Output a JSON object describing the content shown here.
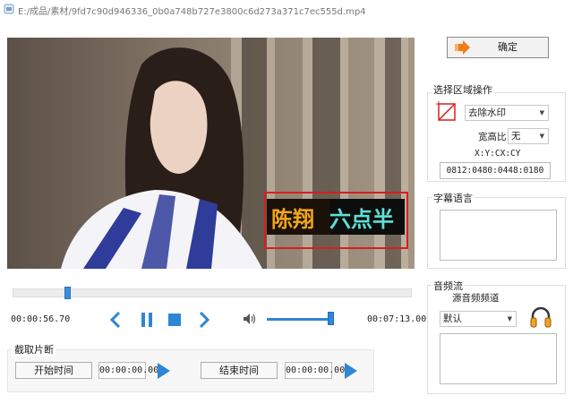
{
  "window": {
    "title": "E:/成品/素材/9fd7c90d946336_0b0a748b727e3800c6d273a371c7ec555d.mp4"
  },
  "video": {
    "overlay_text_left": "陈翔",
    "overlay_text_right": "六点半"
  },
  "playback": {
    "current_time": "00:00:56.70",
    "total_time": "00:07:13.00",
    "progress": 0.13,
    "volume": 0.95
  },
  "clip": {
    "title": "截取片断",
    "start_button": "开始时间",
    "start_value": "00:00:00.00",
    "end_button": "结束时间",
    "end_value": "00:00:00.00"
  },
  "confirm": {
    "label": "确定"
  },
  "region": {
    "title": "选择区域操作",
    "operation": "去除水印",
    "aspect_label": "宽高比",
    "aspect_value": "无",
    "coord_format": "X:Y:CX:CY",
    "coord_value": "0812:0480:0448:0180"
  },
  "subtitle": {
    "title": "字幕语言"
  },
  "audio": {
    "title": "音频流",
    "source_label": "源音频频道",
    "source_value": "默认"
  },
  "colors": {
    "accent": "#2e86d6",
    "selection": "#d81e1e",
    "confirm_icon": "#f07c1a",
    "headphone": "#f2a51c"
  },
  "icons": {
    "app": "app-icon",
    "prev": "chevron-left-icon",
    "pause": "pause-icon",
    "stop": "stop-icon",
    "next": "chevron-right-icon",
    "volume": "speaker-icon",
    "play": "play-icon",
    "confirm": "arrow-right-icon",
    "region": "crop-icon",
    "headphones": "headphones-icon"
  }
}
